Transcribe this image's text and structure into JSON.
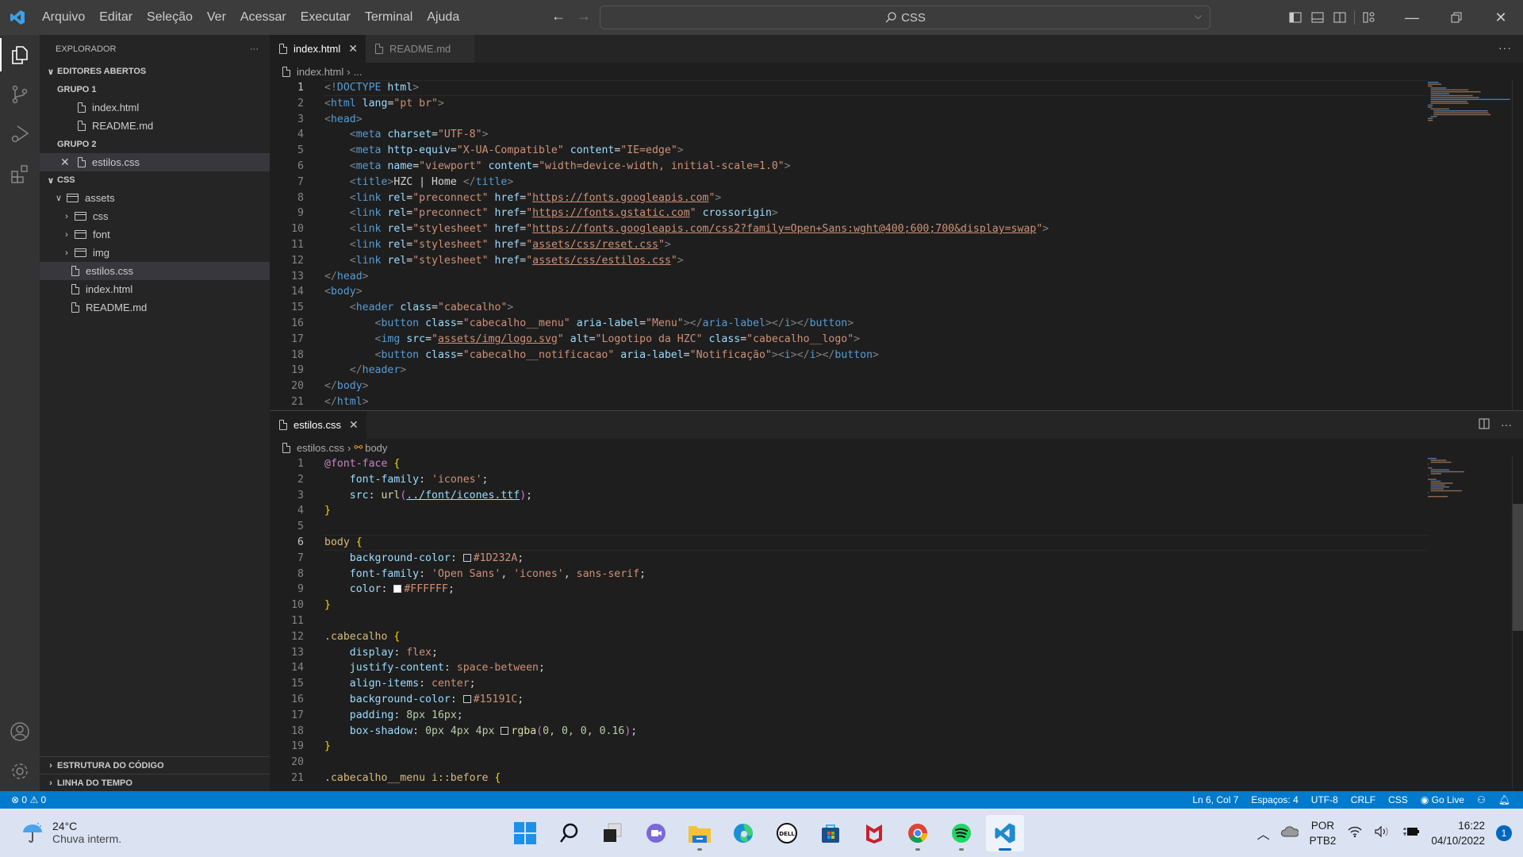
{
  "titlebar": {
    "menu": [
      "Arquivo",
      "Editar",
      "Seleção",
      "Ver",
      "Acessar",
      "Executar",
      "Terminal",
      "Ajuda"
    ],
    "search_text": "CSS",
    "nav_back": "←",
    "nav_forward": "→"
  },
  "sidebar": {
    "title": "EXPLORADOR",
    "more": "···",
    "open_editors_label": "EDITORES ABERTOS",
    "groups": [
      {
        "label": "GRUPO 1",
        "files": [
          "index.html",
          "README.md"
        ]
      },
      {
        "label": "GRUPO 2",
        "files": [
          "estilos.css"
        ]
      }
    ],
    "folder_label": "CSS",
    "tree": {
      "assets": "assets",
      "subfolders": [
        "css",
        "font",
        "img"
      ],
      "files": [
        "estilos.css",
        "index.html",
        "README.md"
      ]
    },
    "outline_label": "ESTRUTURA DO CÓDIGO",
    "timeline_label": "LINHA DO TEMPO"
  },
  "editor_top": {
    "tabs": [
      {
        "label": "index.html",
        "active": true
      },
      {
        "label": "README.md",
        "active": false
      }
    ],
    "breadcrumb": [
      "index.html",
      "..."
    ],
    "current_line": 1,
    "lines": [
      "<!DOCTYPE html>",
      "<html lang=\"pt br\">",
      "<head>",
      "    <meta charset=\"UTF-8\">",
      "    <meta http-equiv=\"X-UA-Compatible\" content=\"IE=edge\">",
      "    <meta name=\"viewport\" content=\"width=device-width, initial-scale=1.0\">",
      "    <title>HZC | Home </title>",
      "    <link rel=\"preconnect\" href=\"https://fonts.googleapis.com\">",
      "    <link rel=\"preconnect\" href=\"https://fonts.gstatic.com\" crossorigin>",
      "    <link rel=\"stylesheet\" href=\"https://fonts.googleapis.com/css2?family=Open+Sans:wght@400;600;700&display=swap\">",
      "    <link rel=\"stylesheet\" href=\"assets/css/reset.css\">",
      "    <link rel=\"stylesheet\" href=\"assets/css/estilos.css\">",
      "</head>",
      "<body>",
      "    <header class=\"cabecalho\">",
      "        <button class=\"cabecalho__menu\" aria-label=\"Menu\"></aria-label></i></button>",
      "        <img src=\"assets/img/logo.svg\" alt=\"Logotipo da HZC\" class=\"cabecalho__logo\">",
      "        <button class=\"cabecalho__notificacao\" aria-label=\"Notificação\"><i></i></button>",
      "    </header>",
      "</body>",
      "</html>"
    ]
  },
  "editor_bottom": {
    "tabs": [
      {
        "label": "estilos.css",
        "active": true
      }
    ],
    "breadcrumb": [
      "estilos.css",
      "body"
    ],
    "current_line": 6,
    "lines": [
      "@font-face {",
      "    font-family: 'icones';",
      "    src: url(../font/icones.ttf);",
      "}",
      "",
      "body {",
      "    background-color: #1D232A;",
      "    font-family: 'Open Sans', 'icones', sans-serif;",
      "    color: #FFFFFF;",
      "}",
      "",
      ".cabecalho {",
      "    display: flex;",
      "    justify-content: space-between;",
      "    align-items: center;",
      "    background-color: #15191C;",
      "    padding: 8px 16px;",
      "    box-shadow: 0px 4px 4px rgba(0, 0, 0, 0.16);",
      "}",
      "",
      ".cabecalho__menu i::before {"
    ],
    "swatches": {
      "body_bg": "#1D232A",
      "body_color": "#FFFFFF",
      "header_bg": "#15191C"
    }
  },
  "statusbar": {
    "errors": "0",
    "warnings": "0",
    "position": "Ln 6, Col 7",
    "spaces": "Espaços: 4",
    "encoding": "UTF-8",
    "eol": "CRLF",
    "language": "CSS",
    "golive": "Go Live"
  },
  "taskbar": {
    "temperature": "24°C",
    "condition": "Chuva interm.",
    "apps": [
      "start",
      "search",
      "task-view",
      "teams-chat",
      "file-explorer",
      "edge",
      "dell",
      "microsoft-store",
      "mcafee",
      "chrome",
      "spotify",
      "vscode"
    ],
    "lang_1": "POR",
    "lang_2": "PTB2",
    "time": "16:22",
    "date": "04/10/2022",
    "notifications": "1"
  },
  "colors": {
    "accent": "#007acc",
    "titlebar": "#3c3c3c",
    "editor_bg": "#1e1e1e",
    "sidebar_bg": "#252526"
  }
}
